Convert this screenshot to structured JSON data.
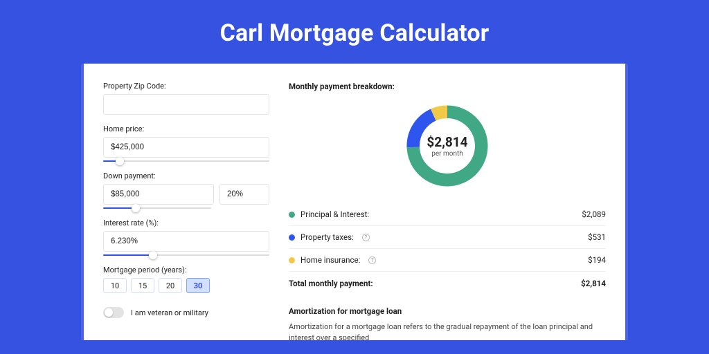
{
  "title": "Carl Mortgage Calculator",
  "form": {
    "zip_label": "Property Zip Code:",
    "zip_value": "",
    "home_price_label": "Home price:",
    "home_price_value": "$425,000",
    "home_price_slider_pct": 10,
    "down_label": "Down payment:",
    "down_value": "$85,000",
    "down_pct_value": "20%",
    "down_slider_pct": 20,
    "rate_label": "Interest rate (%):",
    "rate_value": "6.230%",
    "rate_slider_pct": 30,
    "period_label": "Mortgage period (years):",
    "period_options": [
      "10",
      "15",
      "20",
      "30"
    ],
    "period_selected": "30",
    "veteran_label": "I am veteran or military",
    "veteran_on": false
  },
  "result": {
    "heading": "Monthly payment breakdown:",
    "total_display": "$2,814",
    "total_sub": "per month",
    "rows": [
      {
        "label": "Principal & Interest:",
        "value": "$2,089",
        "color": "green",
        "info": false
      },
      {
        "label": "Property taxes:",
        "value": "$531",
        "color": "blue",
        "info": true
      },
      {
        "label": "Home insurance:",
        "value": "$194",
        "color": "yellow",
        "info": true
      }
    ],
    "total_label": "Total monthly payment:",
    "total_value": "$2,814"
  },
  "chart_data": {
    "type": "pie",
    "title": "Monthly payment breakdown",
    "series": [
      {
        "name": "Principal & Interest",
        "value": 2089,
        "color": "#41a886"
      },
      {
        "name": "Property taxes",
        "value": 531,
        "color": "#2f55ef"
      },
      {
        "name": "Home insurance",
        "value": 194,
        "color": "#f1c948"
      }
    ],
    "center_value": "$2,814",
    "center_sub": "per month"
  },
  "amort": {
    "heading": "Amortization for mortgage loan",
    "body": "Amortization for a mortgage loan refers to the gradual repayment of the loan principal and interest over a specified"
  }
}
